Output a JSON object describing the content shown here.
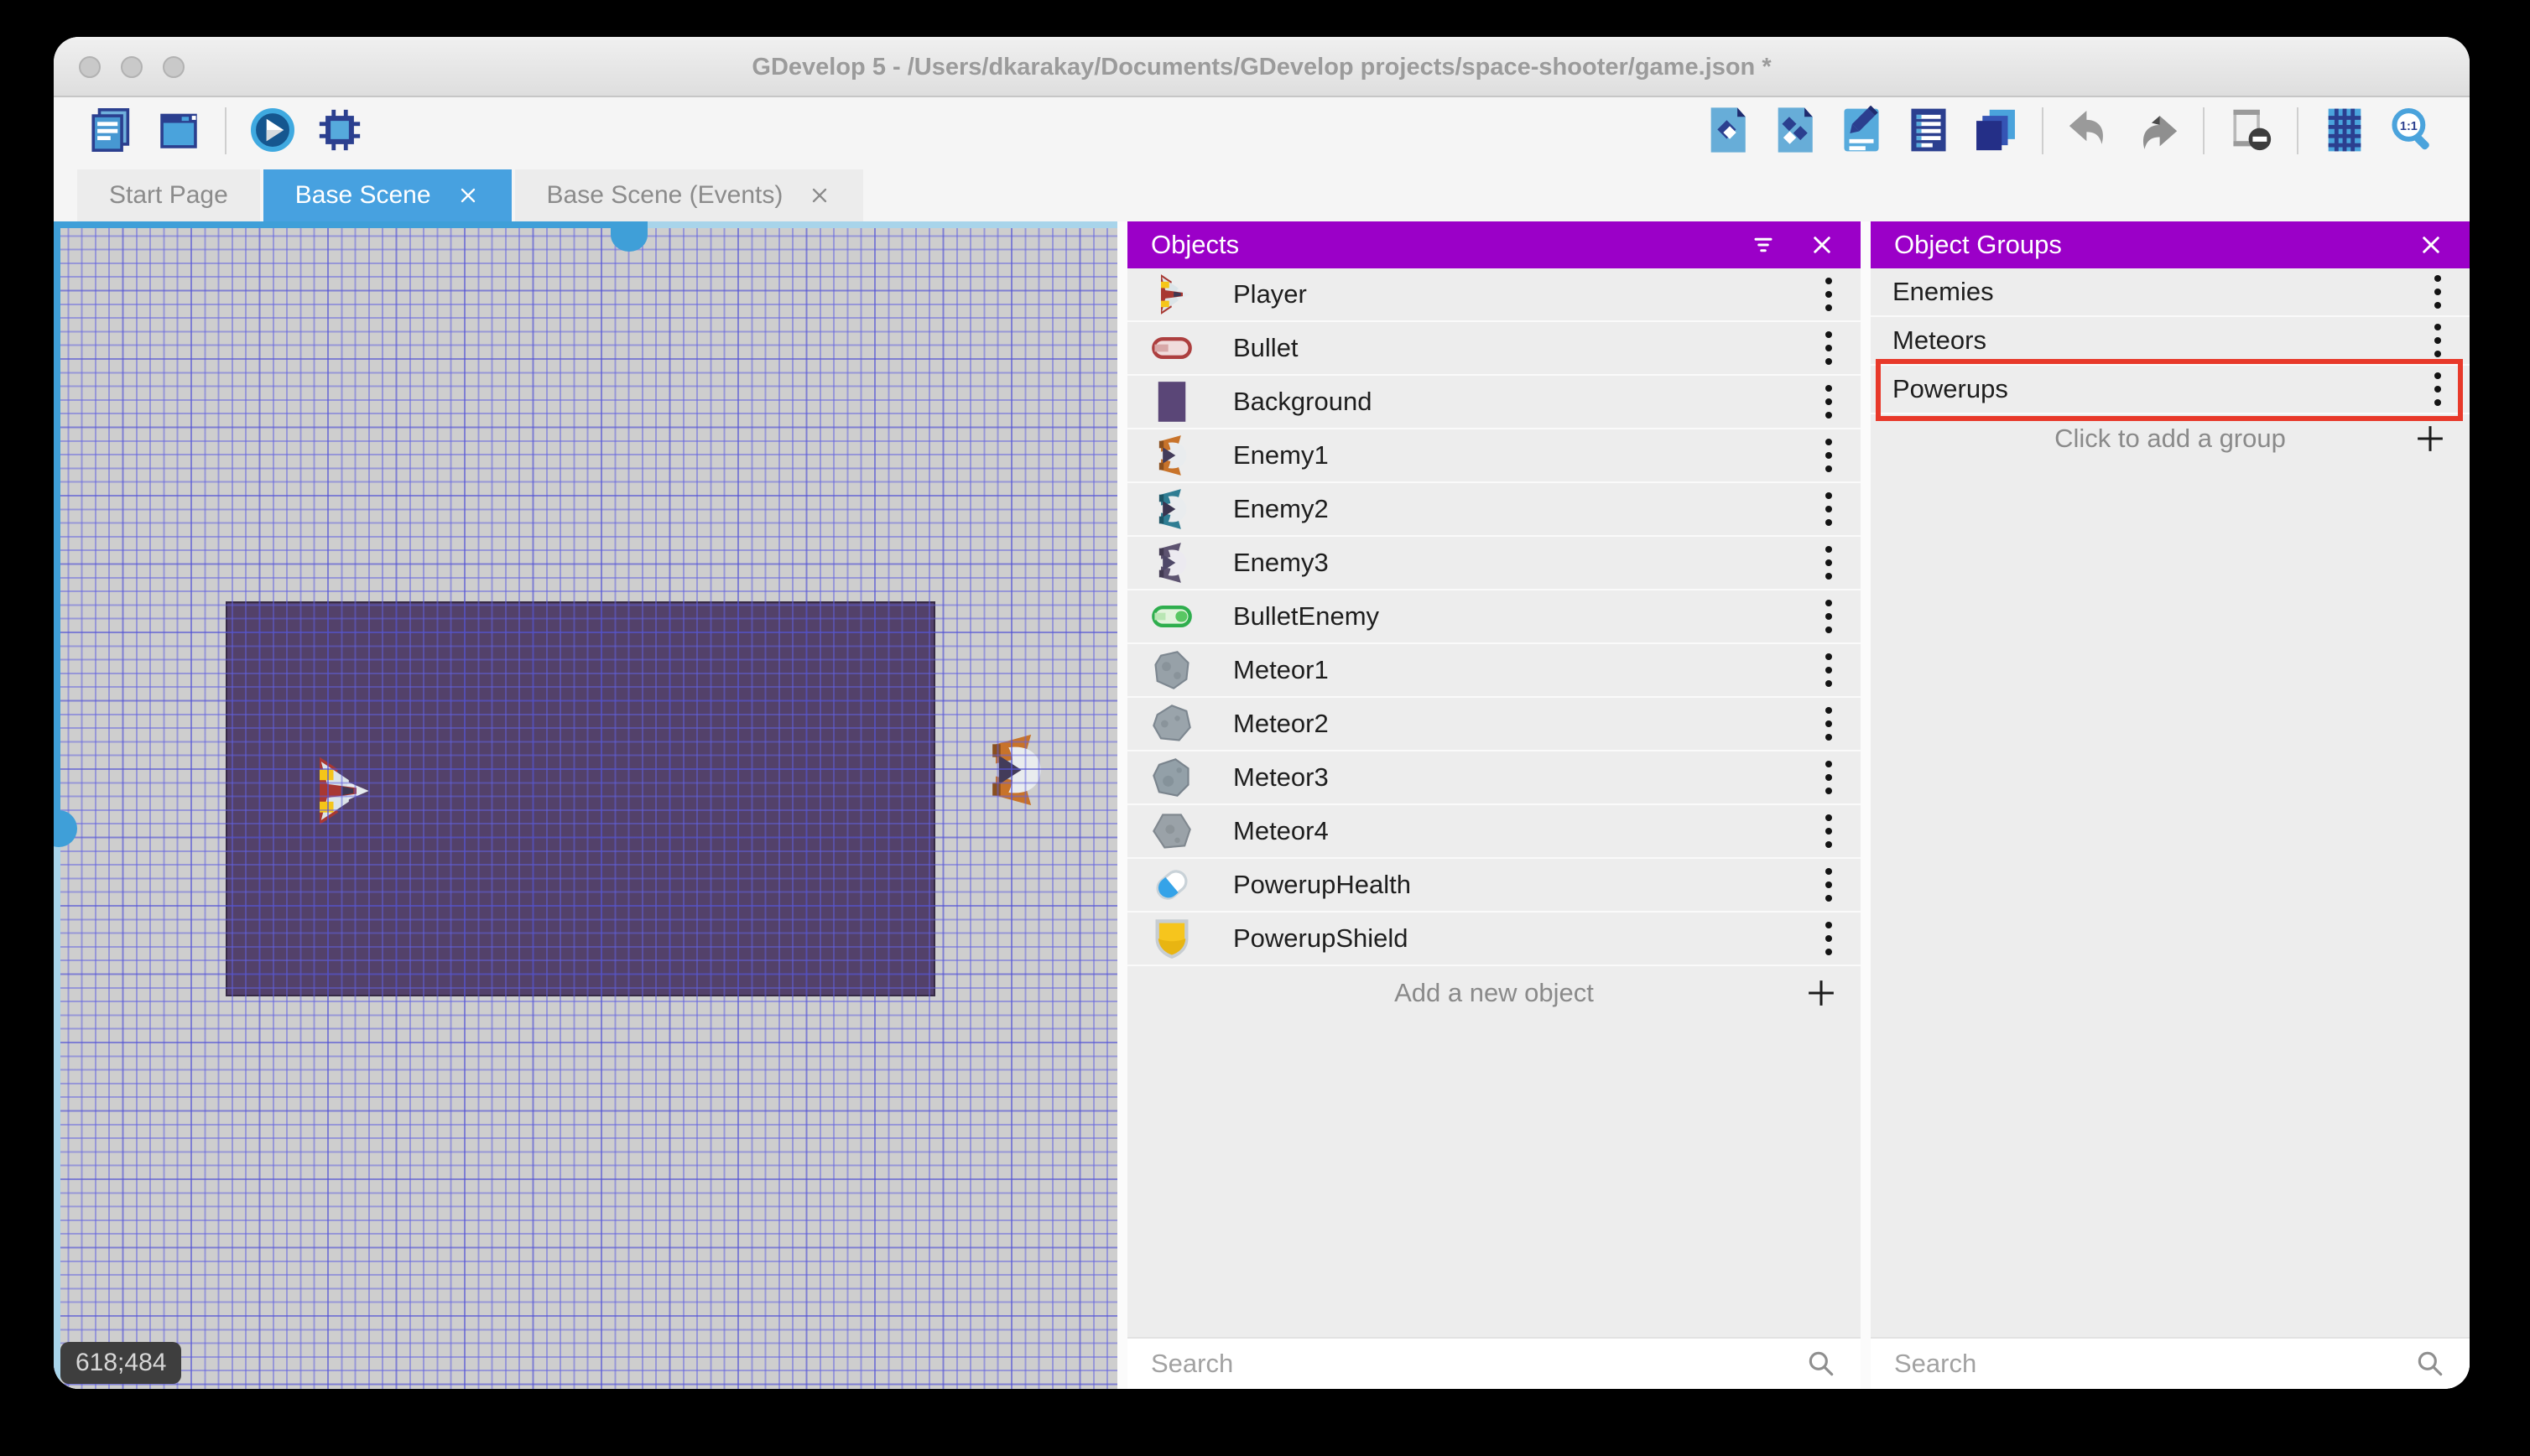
{
  "window": {
    "title": "GDevelop 5 - /Users/dkarakay/Documents/GDevelop projects/space-shooter/game.json *"
  },
  "toolbar": {
    "project_icons": [
      {
        "name": "project-manager"
      },
      {
        "name": "scene-window"
      }
    ],
    "preview_icons": [
      {
        "name": "play-preview"
      },
      {
        "name": "debug"
      }
    ],
    "right_panel_icons": [
      {
        "name": "objects-panel"
      },
      {
        "name": "object-groups-panel"
      },
      {
        "name": "properties-panel"
      },
      {
        "name": "instances-list"
      },
      {
        "name": "layers-panel"
      }
    ],
    "history_icons": [
      {
        "name": "undo"
      },
      {
        "name": "redo"
      }
    ],
    "mask_icons": [
      {
        "name": "toggle-instance-mask"
      }
    ],
    "view_icons": [
      {
        "name": "grid"
      },
      {
        "name": "zoom-1-1"
      }
    ]
  },
  "tabs": [
    {
      "name": "start-page",
      "label": "Start Page",
      "active": false,
      "closable": false
    },
    {
      "name": "base-scene",
      "label": "Base Scene",
      "active": true,
      "closable": true
    },
    {
      "name": "base-scene-events",
      "label": "Base Scene (Events)",
      "active": false,
      "closable": true
    }
  ],
  "canvas": {
    "coordinates": "618;484"
  },
  "objects_panel": {
    "title": "Objects",
    "items": [
      {
        "name": "Player",
        "icon": "player-ship"
      },
      {
        "name": "Bullet",
        "icon": "bullet"
      },
      {
        "name": "Background",
        "icon": "background"
      },
      {
        "name": "Enemy1",
        "icon": "enemy1"
      },
      {
        "name": "Enemy2",
        "icon": "enemy2"
      },
      {
        "name": "Enemy3",
        "icon": "enemy3"
      },
      {
        "name": "BulletEnemy",
        "icon": "bullet-enemy"
      },
      {
        "name": "Meteor1",
        "icon": "meteor1"
      },
      {
        "name": "Meteor2",
        "icon": "meteor2"
      },
      {
        "name": "Meteor3",
        "icon": "meteor3"
      },
      {
        "name": "Meteor4",
        "icon": "meteor4"
      },
      {
        "name": "PowerupHealth",
        "icon": "powerup-health"
      },
      {
        "name": "PowerupShield",
        "icon": "powerup-shield"
      }
    ],
    "add_label": "Add a new object",
    "search_placeholder": "Search"
  },
  "groups_panel": {
    "title": "Object Groups",
    "items": [
      {
        "name": "Enemies",
        "highlighted": false
      },
      {
        "name": "Meteors",
        "highlighted": false
      },
      {
        "name": "Powerups",
        "highlighted": true
      }
    ],
    "add_label": "Click to add a group",
    "search_placeholder": "Search"
  },
  "colors": {
    "panel_header": "#9b00c8",
    "active_tab": "#47a1e0",
    "highlight_box": "#e8392a"
  }
}
